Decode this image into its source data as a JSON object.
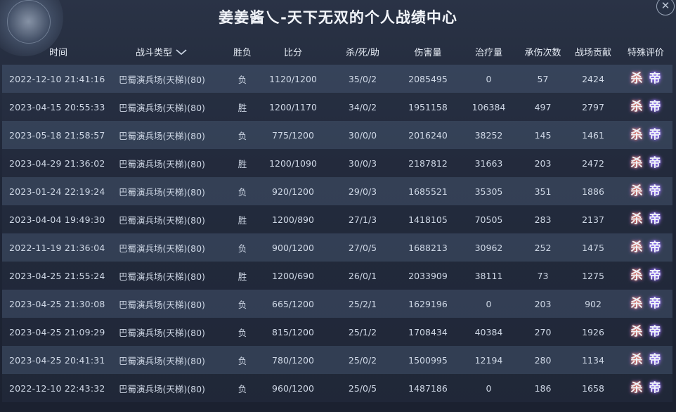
{
  "title": "姜姜酱乀-天下无双的个人战绩中心",
  "columns": [
    "时间",
    "战斗类型",
    "胜负",
    "比分",
    "杀/死/助",
    "伤害量",
    "治疗量",
    "承伤次数",
    "战场贡献",
    "特殊评价"
  ],
  "badges": {
    "kill": "杀",
    "emperor": "帝"
  },
  "rows": [
    {
      "time": "2022-12-10 21:41:16",
      "type": "巴蜀演兵场(天梯)(80)",
      "result": "负",
      "score": "1120/1200",
      "kda": "35/0/2",
      "damage": "2085495",
      "heal": "0",
      "hits": "57",
      "contribution": "2424"
    },
    {
      "time": "2023-04-15 20:55:33",
      "type": "巴蜀演兵场(天梯)(80)",
      "result": "胜",
      "score": "1200/1170",
      "kda": "34/0/2",
      "damage": "1951158",
      "heal": "106384",
      "hits": "497",
      "contribution": "2797"
    },
    {
      "time": "2023-05-18 21:58:57",
      "type": "巴蜀演兵场(天梯)(80)",
      "result": "负",
      "score": "775/1200",
      "kda": "30/0/0",
      "damage": "2016240",
      "heal": "38252",
      "hits": "145",
      "contribution": "1461"
    },
    {
      "time": "2023-04-29 21:36:02",
      "type": "巴蜀演兵场(天梯)(80)",
      "result": "胜",
      "score": "1200/1090",
      "kda": "30/0/3",
      "damage": "2187812",
      "heal": "31663",
      "hits": "203",
      "contribution": "2472"
    },
    {
      "time": "2023-01-24 22:19:24",
      "type": "巴蜀演兵场(天梯)(80)",
      "result": "负",
      "score": "920/1200",
      "kda": "29/0/3",
      "damage": "1685521",
      "heal": "35305",
      "hits": "351",
      "contribution": "1886"
    },
    {
      "time": "2023-04-04 19:49:30",
      "type": "巴蜀演兵场(天梯)(80)",
      "result": "胜",
      "score": "1200/890",
      "kda": "27/1/3",
      "damage": "1418105",
      "heal": "70505",
      "hits": "283",
      "contribution": "2137"
    },
    {
      "time": "2022-11-19 21:36:04",
      "type": "巴蜀演兵场(天梯)(80)",
      "result": "负",
      "score": "900/1200",
      "kda": "27/0/5",
      "damage": "1688213",
      "heal": "30962",
      "hits": "252",
      "contribution": "1475"
    },
    {
      "time": "2023-04-25 21:55:24",
      "type": "巴蜀演兵场(天梯)(80)",
      "result": "胜",
      "score": "1200/690",
      "kda": "26/0/1",
      "damage": "2033909",
      "heal": "38111",
      "hits": "73",
      "contribution": "1275"
    },
    {
      "time": "2023-04-25 21:30:08",
      "type": "巴蜀演兵场(天梯)(80)",
      "result": "负",
      "score": "665/1200",
      "kda": "25/2/1",
      "damage": "1629196",
      "heal": "0",
      "hits": "203",
      "contribution": "902"
    },
    {
      "time": "2023-04-25 21:09:29",
      "type": "巴蜀演兵场(天梯)(80)",
      "result": "负",
      "score": "815/1200",
      "kda": "25/1/2",
      "damage": "1708434",
      "heal": "40384",
      "hits": "270",
      "contribution": "1926"
    },
    {
      "time": "2023-04-25 20:41:31",
      "type": "巴蜀演兵场(天梯)(80)",
      "result": "负",
      "score": "780/1200",
      "kda": "25/0/2",
      "damage": "1500995",
      "heal": "12194",
      "hits": "280",
      "contribution": "1134"
    },
    {
      "time": "2022-12-10 22:43:32",
      "type": "巴蜀演兵场(天梯)(80)",
      "result": "负",
      "score": "960/1200",
      "kda": "25/0/5",
      "damage": "1487186",
      "heal": "0",
      "hits": "186",
      "contribution": "1658"
    }
  ]
}
